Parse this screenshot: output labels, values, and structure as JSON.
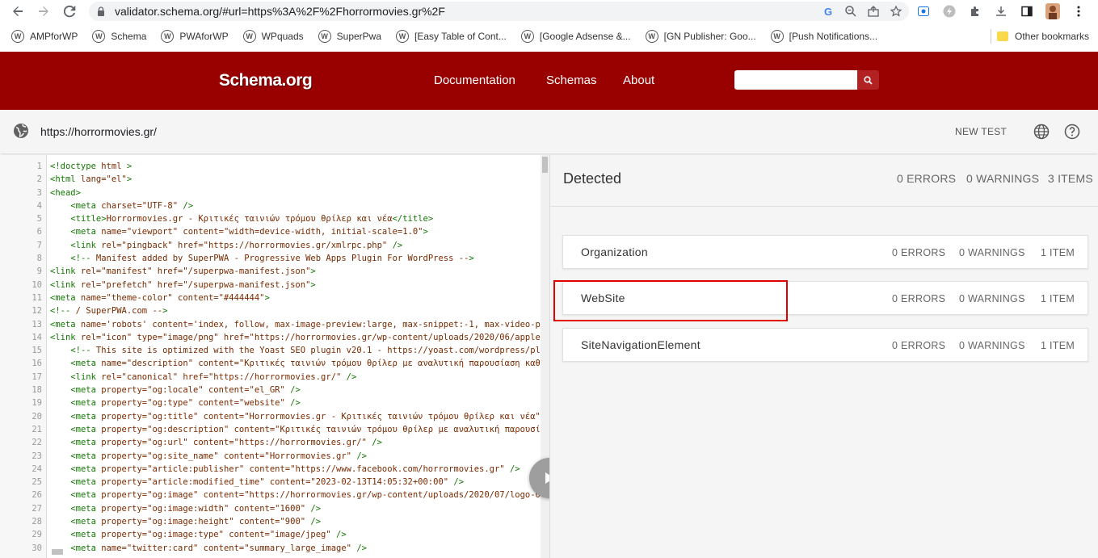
{
  "browser": {
    "url": "validator.schema.org/#url=https%3A%2F%2Fhorrormovies.gr%2F",
    "bookmarks": [
      "AMPforWP",
      "Schema",
      "PWAforWP",
      "WPquads",
      "SuperPwa",
      "[Easy Table of Cont...",
      "[Google Adsense &...",
      "[GN Publisher: Goo...",
      "[Push Notifications..."
    ],
    "other_bookmarks": "Other bookmarks"
  },
  "header": {
    "logo": "Schema.org",
    "nav": [
      "Documentation",
      "Schemas",
      "About"
    ],
    "search_placeholder": ""
  },
  "toolbar": {
    "url": "https://horrormovies.gr/",
    "new_test": "NEW TEST"
  },
  "code": {
    "lines": [
      {
        "n": "1",
        "t": "<!doctype html >"
      },
      {
        "n": "2",
        "t": "<html lang=\"el\">"
      },
      {
        "n": "3",
        "t": "<head>"
      },
      {
        "n": "4",
        "t": "    <meta charset=\"UTF-8\" />"
      },
      {
        "n": "5",
        "t": "    <title>Horrormovies.gr - Κριτικές ταινιών τρόμου θρίλερ και νέα</title>"
      },
      {
        "n": "6",
        "t": "    <meta name=\"viewport\" content=\"width=device-width, initial-scale=1.0\">"
      },
      {
        "n": "7",
        "t": "    <link rel=\"pingback\" href=\"https://horrormovies.gr/xmlrpc.php\" />"
      },
      {
        "n": "8",
        "t": "    <!-- Manifest added by SuperPWA - Progressive Web Apps Plugin For WordPress -->"
      },
      {
        "n": "9",
        "t": "<link rel=\"manifest\" href=\"/superpwa-manifest.json\">"
      },
      {
        "n": "10",
        "t": "<link rel=\"prefetch\" href=\"/superpwa-manifest.json\">"
      },
      {
        "n": "11",
        "t": "<meta name=\"theme-color\" content=\"#444444\">"
      },
      {
        "n": "12",
        "t": "<!-- / SuperPWA.com -->"
      },
      {
        "n": "13",
        "t": "<meta name='robots' content='index, follow, max-image-preview:large, max-snippet:-1, max-video-p"
      },
      {
        "n": "14",
        "t": "<link rel=\"icon\" type=\"image/png\" href=\"https://horrormovies.gr/wp-content/uploads/2020/06/apple"
      },
      {
        "n": "15",
        "t": "    <!-- This site is optimized with the Yoast SEO plugin v20.1 - https://yoast.com/wordpress/pl"
      },
      {
        "n": "16",
        "t": "    <meta name=\"description\" content=\"Κριτικές ταινιών τρόμου θρίλερ με αναλυτική παρουσίαση καθ"
      },
      {
        "n": "17",
        "t": "    <link rel=\"canonical\" href=\"https://horrormovies.gr/\" />"
      },
      {
        "n": "18",
        "t": "    <meta property=\"og:locale\" content=\"el_GR\" />"
      },
      {
        "n": "19",
        "t": "    <meta property=\"og:type\" content=\"website\" />"
      },
      {
        "n": "20",
        "t": "    <meta property=\"og:title\" content=\"Horrormovies.gr - Κριτικές ταινιών τρόμου θρίλερ και νέα\""
      },
      {
        "n": "21",
        "t": "    <meta property=\"og:description\" content=\"Κριτικές ταινιών τρόμου θρίλερ με αναλυτική παρουσί"
      },
      {
        "n": "22",
        "t": "    <meta property=\"og:url\" content=\"https://horrormovies.gr/\" />"
      },
      {
        "n": "23",
        "t": "    <meta property=\"og:site_name\" content=\"Horrormovies.gr\" />"
      },
      {
        "n": "24",
        "t": "    <meta property=\"article:publisher\" content=\"https://www.facebook.com/horrormovies.gr\" />"
      },
      {
        "n": "25",
        "t": "    <meta property=\"article:modified_time\" content=\"2023-02-13T14:05:32+00:00\" />"
      },
      {
        "n": "26",
        "t": "    <meta property=\"og:image\" content=\"https://horrormovies.gr/wp-content/uploads/2020/07/logo-0"
      },
      {
        "n": "27",
        "t": "    <meta property=\"og:image:width\" content=\"1600\" />"
      },
      {
        "n": "28",
        "t": "    <meta property=\"og:image:height\" content=\"900\" />"
      },
      {
        "n": "29",
        "t": "    <meta property=\"og:image:type\" content=\"image/jpeg\" />"
      },
      {
        "n": "30",
        "t": "    <meta name=\"twitter:card\" content=\"summary_large_image\" />"
      }
    ]
  },
  "detected": {
    "title": "Detected",
    "errors": "0 ERRORS",
    "warnings": "0 WARNINGS",
    "items": "3 ITEMS",
    "cards": [
      {
        "name": "Organization",
        "errors": "0 ERRORS",
        "warnings": "0 WARNINGS",
        "items": "1 ITEM"
      },
      {
        "name": "WebSite",
        "errors": "0 ERRORS",
        "warnings": "0 WARNINGS",
        "items": "1 ITEM"
      },
      {
        "name": "SiteNavigationElement",
        "errors": "0 ERRORS",
        "warnings": "0 WARNINGS",
        "items": "1 ITEM"
      }
    ]
  },
  "colors": {
    "brand": "#990000",
    "highlight": "#e00000"
  }
}
